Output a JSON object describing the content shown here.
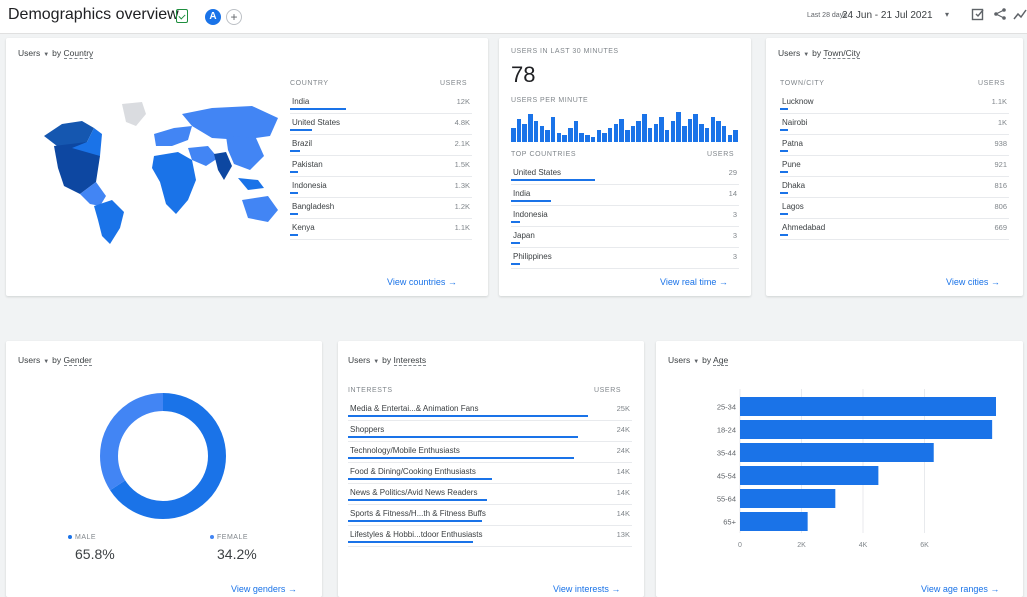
{
  "header": {
    "title": "Demographics overview",
    "avatar_letter": "A",
    "add_comparison": "+",
    "date_prefix": "Last 28 days",
    "date_range": "24 Jun - 21 Jul 2021",
    "date_caret": "▾"
  },
  "country_card": {
    "metric": "Users",
    "dimension_prefix": "by",
    "dimension": "Country",
    "col_dim": "COUNTRY",
    "col_metric": "USERS",
    "rows": [
      {
        "label": "India",
        "value": "12K",
        "share": 1.0
      },
      {
        "label": "United States",
        "value": "4.8K",
        "share": 0.4
      },
      {
        "label": "Brazil",
        "value": "2.1K",
        "share": 0.18
      },
      {
        "label": "Pakistan",
        "value": "1.5K",
        "share": 0.13
      },
      {
        "label": "Indonesia",
        "value": "1.3K",
        "share": 0.11
      },
      {
        "label": "Bangladesh",
        "value": "1.2K",
        "share": 0.1
      },
      {
        "label": "Kenya",
        "value": "1.1K",
        "share": 0.09
      }
    ],
    "link": "View countries"
  },
  "realtime_card": {
    "header": "USERS IN LAST 30 MINUTES",
    "value": "78",
    "per_minute_label": "USERS PER MINUTE",
    "per_minute": [
      6,
      10,
      8,
      12,
      9,
      7,
      5,
      11,
      4,
      3,
      6,
      9,
      4,
      3,
      2,
      5,
      4,
      6,
      8,
      10,
      5,
      7,
      9,
      12,
      6,
      8,
      11,
      5,
      9,
      13,
      7,
      10,
      12,
      8,
      6,
      11,
      9,
      7,
      3,
      5
    ],
    "col_dim": "TOP COUNTRIES",
    "col_metric": "USERS",
    "rows": [
      {
        "label": "United States",
        "value": "29",
        "share": 1.0
      },
      {
        "label": "India",
        "value": "14",
        "share": 0.48
      },
      {
        "label": "Indonesia",
        "value": "3",
        "share": 0.11
      },
      {
        "label": "Japan",
        "value": "3",
        "share": 0.11
      },
      {
        "label": "Philippines",
        "value": "3",
        "share": 0.11
      }
    ],
    "link": "View real time"
  },
  "city_card": {
    "metric": "Users",
    "dimension_prefix": "by",
    "dimension": "Town/City",
    "col_dim": "TOWN/CITY",
    "col_metric": "USERS",
    "rows": [
      {
        "label": "Lucknow",
        "value": "1.1K",
        "share": 0.03
      },
      {
        "label": "Nairobi",
        "value": "1K",
        "share": 0.03
      },
      {
        "label": "Patna",
        "value": "938",
        "share": 0.03
      },
      {
        "label": "Pune",
        "value": "921",
        "share": 0.03
      },
      {
        "label": "Dhaka",
        "value": "816",
        "share": 0.03
      },
      {
        "label": "Lagos",
        "value": "806",
        "share": 0.03
      },
      {
        "label": "Ahmedabad",
        "value": "669",
        "share": 0.02
      }
    ],
    "link": "View cities"
  },
  "gender_card": {
    "metric": "Users",
    "dimension_prefix": "by",
    "dimension": "Gender",
    "male_label": "MALE",
    "male_value": "65.8%",
    "male_share": 0.658,
    "female_label": "FEMALE",
    "female_value": "34.2%",
    "female_share": 0.342,
    "link": "View genders"
  },
  "interests_card": {
    "metric": "Users",
    "dimension_prefix": "by",
    "dimension": "Interests",
    "col_dim": "INTERESTS",
    "col_metric": "USERS",
    "rows": [
      {
        "label": "Media & Entertai...& Animation Fans",
        "value": "25K",
        "share": 1.0
      },
      {
        "label": "Shoppers",
        "value": "24K",
        "share": 0.96
      },
      {
        "label": "Technology/Mobile Enthusiasts",
        "value": "24K",
        "share": 0.94
      },
      {
        "label": "Food & Dining/Cooking Enthusiasts",
        "value": "14K",
        "share": 0.6
      },
      {
        "label": "News & Politics/Avid News Readers",
        "value": "14K",
        "share": 0.58
      },
      {
        "label": "Sports & Fitness/H...th & Fitness Buffs",
        "value": "14K",
        "share": 0.56
      },
      {
        "label": "Lifestyles & Hobbi...tdoor Enthusiasts",
        "value": "13K",
        "share": 0.52
      }
    ],
    "link": "View interests"
  },
  "age_card": {
    "metric": "Users",
    "dimension_prefix": "by",
    "dimension": "Age",
    "link": "View age ranges"
  },
  "colors": {
    "accent": "#1a73e8",
    "female": "#4285f4",
    "bar": "#1a73e8"
  },
  "chart_data": [
    {
      "type": "bar",
      "orientation": "horizontal",
      "categories": [
        "25-34",
        "18-24",
        "35-44",
        "45-54",
        "55-64",
        "65+"
      ],
      "values": [
        8600,
        8200,
        6300,
        4500,
        3100,
        2200
      ],
      "xticks": [
        "0",
        "2K",
        "4K",
        "6K"
      ],
      "xlim": [
        0,
        8000
      ],
      "grid": true
    },
    {
      "type": "pie",
      "donut": true,
      "categories": [
        "MALE",
        "FEMALE"
      ],
      "values": [
        65.8,
        34.2
      ]
    }
  ]
}
